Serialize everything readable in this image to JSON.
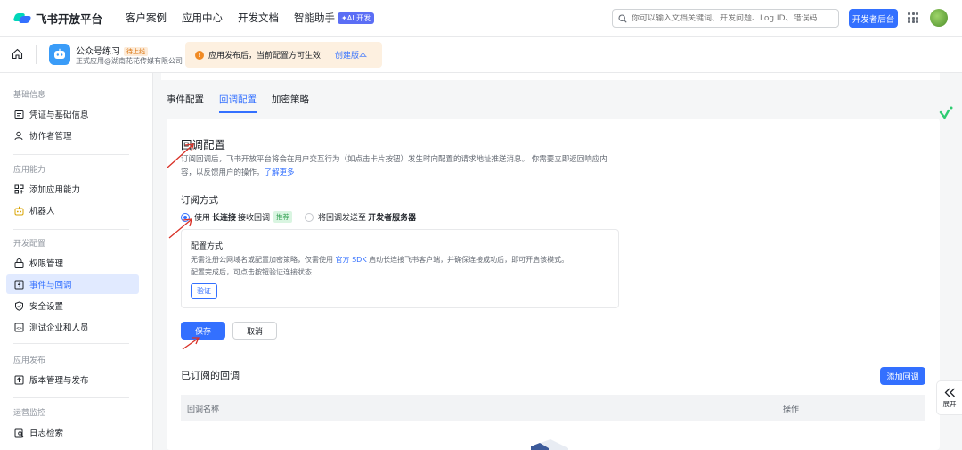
{
  "topnav": {
    "logo": "飞书开放平台",
    "menu": [
      "客户案例",
      "应用中心",
      "开发文档",
      "智能助手"
    ],
    "ai_badge": "✦AI 开发",
    "search_placeholder": "你可以输入文档关键词、开发问题、Log ID、错误码",
    "dev_console": "开发者后台"
  },
  "appbar": {
    "app_name": "公众号练习",
    "app_tag": "待上线",
    "app_sub": "正式应用@湖南花花传媒有限公司",
    "notice_text": "应用发布后，当前配置方可生效",
    "notice_link": "创建版本"
  },
  "sidebar": {
    "groups": [
      "基础信息",
      "应用能力",
      "开发配置",
      "应用发布",
      "运营监控"
    ],
    "items": [
      {
        "label": "凭证与基础信息",
        "icon": "credential-icon"
      },
      {
        "label": "协作者管理",
        "icon": "user-icon"
      },
      {
        "label": "添加应用能力",
        "icon": "grid-add-icon"
      },
      {
        "label": "机器人",
        "icon": "robot-icon"
      },
      {
        "label": "权限管理",
        "icon": "permission-icon"
      },
      {
        "label": "事件与回调",
        "icon": "event-icon"
      },
      {
        "label": "安全设置",
        "icon": "shield-icon"
      },
      {
        "label": "测试企业和人员",
        "icon": "test-icon"
      },
      {
        "label": "版本管理与发布",
        "icon": "upload-icon"
      },
      {
        "label": "日志检索",
        "icon": "log-search-icon"
      }
    ]
  },
  "tabs": [
    "事件配置",
    "回调配置",
    "加密策略"
  ],
  "callback": {
    "title": "回调配置",
    "desc_line1": "订阅回调后，飞书开放平台将会在用户交互行为（如点击卡片按钮）发生时向配置的请求地址推送消息。 你需要立即返回响应内",
    "desc_line2": "容，以反馈用户的操作。",
    "desc_link": "了解更多",
    "sub_label": "订阅方式",
    "opt1_pre": "使用",
    "opt1_bold": "长连接",
    "opt1_post": "接收回调",
    "opt1_tag": "推荐",
    "opt2_pre": "将回调发送至",
    "opt2_bold": "开发者服务器",
    "cfg_title": "配置方式",
    "cfg_line1_pre": "无需注册公网域名或配置加密策略，仅需使用",
    "cfg_line1_link": "官方 SDK",
    "cfg_line1_post": "启动长连接飞书客户端，并确保连接成功后，即可开启该模式。",
    "cfg_line2": "配置完成后，可点击按钮验证连接状态",
    "verify": "验证",
    "save": "保存",
    "cancel": "取消"
  },
  "subscribed": {
    "title": "已订阅的回调",
    "add_button": "添加回调",
    "col_name": "回调名称",
    "col_action": "操作"
  },
  "expand_label": "展开",
  "colors": {
    "accent": "#3370ff",
    "arrow": "#d93026",
    "notice_bg": "#fdf0e0"
  }
}
